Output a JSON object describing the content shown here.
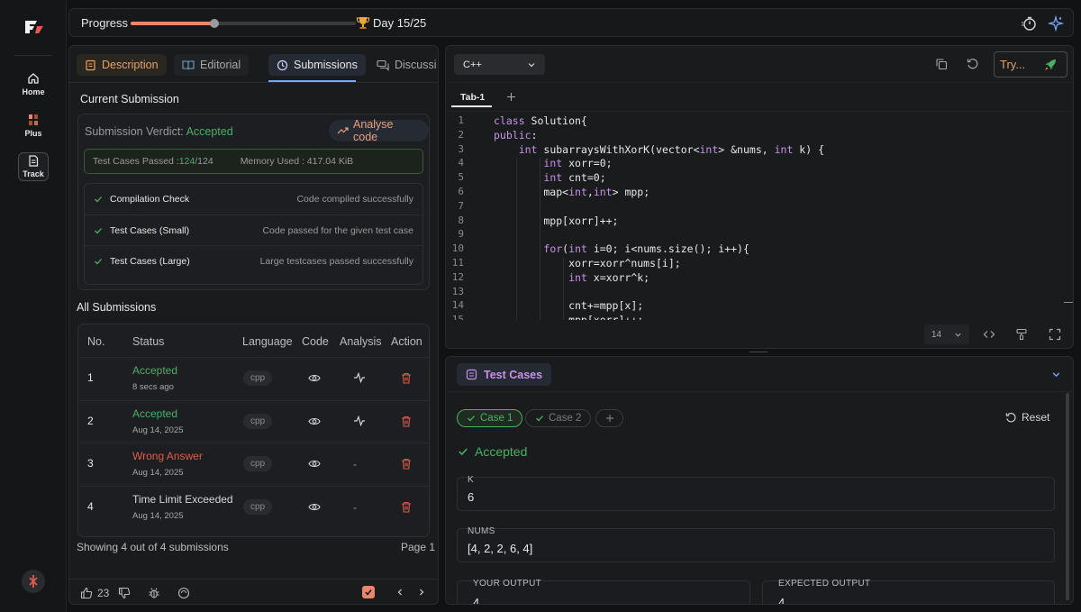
{
  "rail": {
    "items": [
      {
        "label": "Home"
      },
      {
        "label": "Plus"
      },
      {
        "label": "Track"
      }
    ]
  },
  "topbar": {
    "progress_label": "Progress",
    "progress_value": 0.37,
    "day_label": "Day 15/25"
  },
  "left": {
    "tabs": [
      "Description",
      "Editorial",
      "Submissions",
      "Discussi"
    ],
    "current_submission_title": "Current Submission",
    "verdict_label": "Submission Verdict: ",
    "verdict_value": "Accepted",
    "analyse_label": "Analyse code",
    "tests_passed_label": "Test Cases Passed : ",
    "tests_passed_value": "124",
    "tests_total": "/124",
    "memory_label": "Memory Used : 417.04 KiB",
    "checks": [
      {
        "name": "Compilation Check",
        "detail": "Code compiled successfully"
      },
      {
        "name": "Test Cases (Small)",
        "detail": "Code passed for the given test case"
      },
      {
        "name": "Test Cases (Large)",
        "detail": "Large testcases passed successfully"
      }
    ],
    "all_submissions_title": "All Submissions",
    "columns": [
      "No.",
      "Status",
      "Language",
      "Code",
      "Analysis",
      "Action"
    ],
    "rows": [
      {
        "no": "1",
        "status": "Accepted",
        "date": "8 secs ago",
        "lang": "cpp",
        "analysis": "",
        "status_color": "#4caf65"
      },
      {
        "no": "2",
        "status": "Accepted",
        "date": "Aug 14, 2025",
        "lang": "cpp",
        "analysis": "",
        "status_color": "#4caf65"
      },
      {
        "no": "3",
        "status": "Wrong Answer",
        "date": "Aug 14, 2025",
        "lang": "cpp",
        "analysis": "-",
        "status_color": "#e05d4d"
      },
      {
        "no": "4",
        "status": "Time Limit Exceeded",
        "date": "Aug 14, 2025",
        "lang": "cpp",
        "analysis": "-",
        "status_color": "#d6d6d6"
      }
    ],
    "showing": "Showing 4 out of 4 submissions",
    "page": "Page 1",
    "likes": "23"
  },
  "editor": {
    "language": "C++",
    "try_label": "Try...",
    "tab": "Tab-1",
    "font_size": "14",
    "lines": [
      "1",
      "2",
      "3",
      "4",
      "5",
      "6",
      "7",
      "8",
      "9",
      "10",
      "11",
      "12",
      "13",
      "14",
      "15"
    ]
  },
  "tests": {
    "title": "Test Cases",
    "case1": "Case 1",
    "case2": "Case 2",
    "reset": "Reset",
    "verdict": "Accepted",
    "k_label": "K",
    "k_value": "6",
    "nums_label": "NUMS",
    "nums_value": "[4, 2, 2, 6, 4]",
    "your_output_label": "YOUR OUTPUT",
    "your_output_value": "4",
    "expected_output_label": "EXPECTED OUTPUT",
    "expected_output_value": "4"
  },
  "colors": {
    "accent": "#e8876b",
    "accepted": "#4caf65",
    "wrong": "#e05d4d",
    "link": "#7aa7ff",
    "purple": "#c792ea"
  }
}
